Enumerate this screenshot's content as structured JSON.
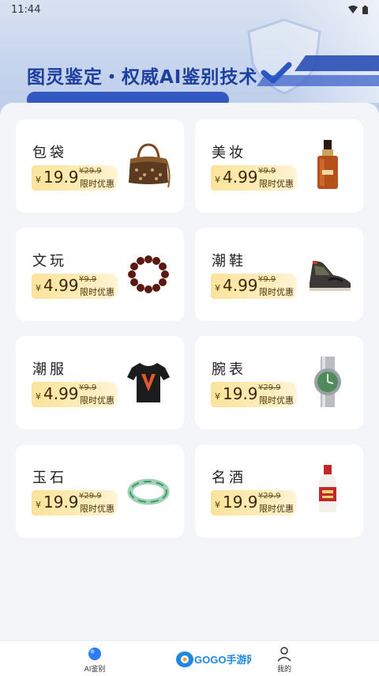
{
  "status_bar": {
    "time": "11:44"
  },
  "banner": {
    "title": "图灵鉴定・权威AI鉴别技术"
  },
  "categories": [
    {
      "name": "包袋",
      "price": "19.9",
      "original_price": "¥29.9",
      "promo": "限时优惠",
      "icon": "handbag-icon"
    },
    {
      "name": "美妆",
      "price": "4.99",
      "original_price": "¥9.9",
      "promo": "限时优惠",
      "icon": "serum-bottle-icon"
    },
    {
      "name": "文玩",
      "price": "4.99",
      "original_price": "¥9.9",
      "promo": "限时优惠",
      "icon": "bead-bracelet-icon"
    },
    {
      "name": "潮鞋",
      "price": "4.99",
      "original_price": "¥9.9",
      "promo": "限时优惠",
      "icon": "sneaker-icon"
    },
    {
      "name": "潮服",
      "price": "4.99",
      "original_price": "¥9.9",
      "promo": "限时优惠",
      "icon": "tshirt-icon"
    },
    {
      "name": "腕表",
      "price": "19.9",
      "original_price": "¥29.9",
      "promo": "限时优惠",
      "icon": "wristwatch-icon"
    },
    {
      "name": "玉石",
      "price": "19.9",
      "original_price": "¥29.9",
      "promo": "限时优惠",
      "icon": "jade-bangle-icon"
    },
    {
      "name": "名酒",
      "price": "19.9",
      "original_price": "¥29.9",
      "promo": "限时优惠",
      "icon": "liquor-bottle-icon"
    }
  ],
  "currency_symbol": "¥",
  "tabbar": {
    "ai_label": "AI鉴别",
    "logo_text": "GOGO手游网",
    "mine_label": "我的"
  },
  "colors": {
    "accent": "#1f3f9e",
    "tab_active": "#2b7cf6",
    "price_tag": "#fbe39b"
  }
}
